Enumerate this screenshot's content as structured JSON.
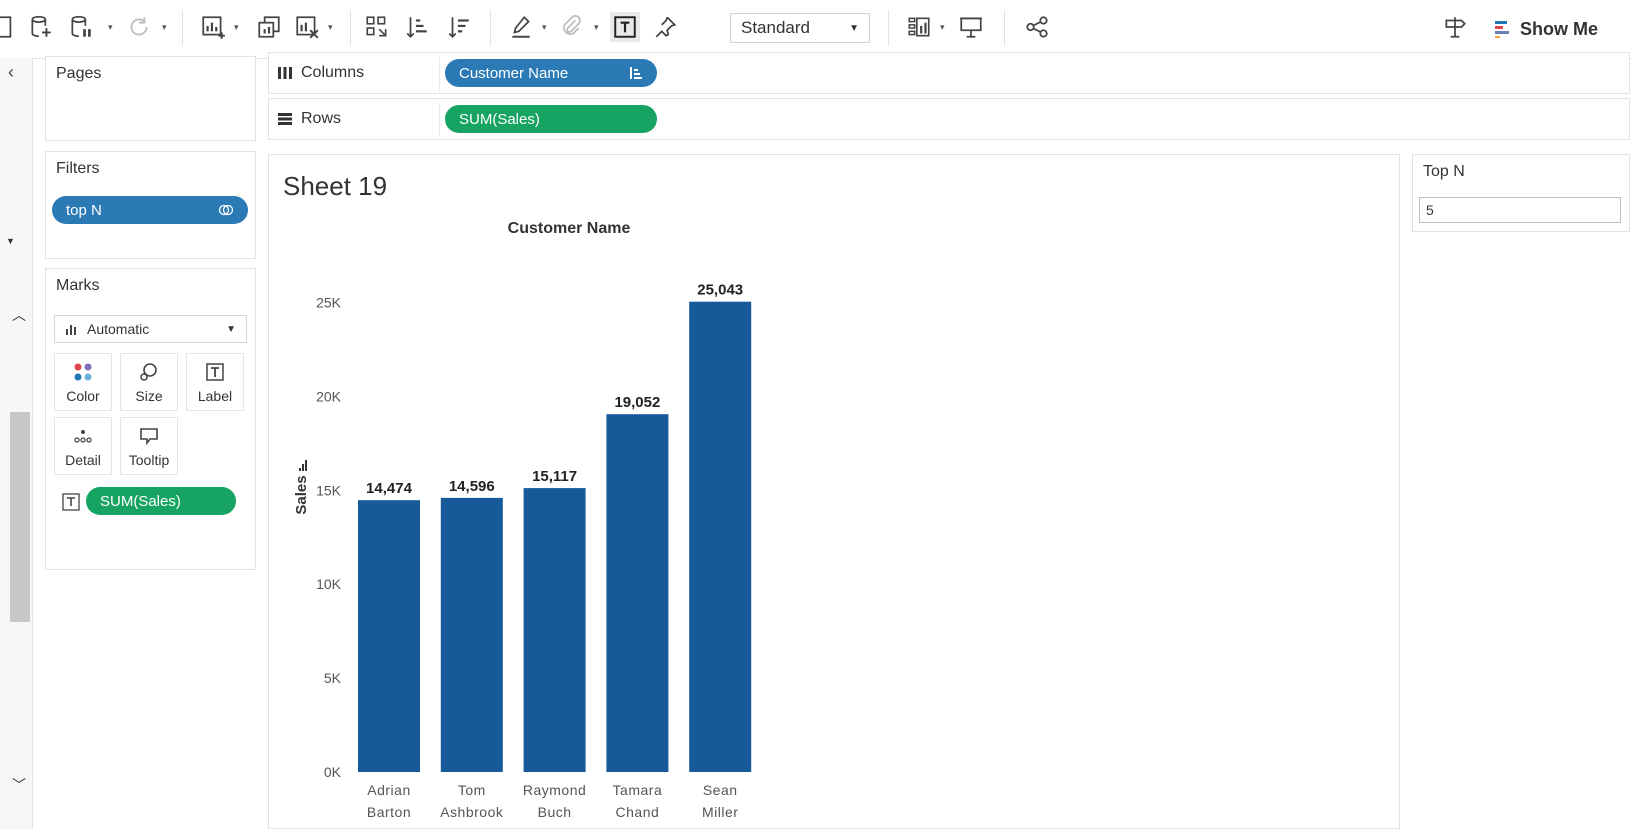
{
  "toolbar": {
    "fit_option": "Standard",
    "show_me_label": "Show Me"
  },
  "pages": {
    "title": "Pages"
  },
  "filters": {
    "title": "Filters",
    "pills": [
      {
        "label": "top N"
      }
    ]
  },
  "marks": {
    "title": "Marks",
    "mark_type": "Automatic",
    "buttons": {
      "color": "Color",
      "size": "Size",
      "label": "Label",
      "detail": "Detail",
      "tooltip": "Tooltip"
    },
    "label_pill": "SUM(Sales)"
  },
  "shelves": {
    "columns": {
      "label": "Columns",
      "pill": "Customer Name"
    },
    "rows": {
      "label": "Rows",
      "pill": "SUM(Sales)"
    }
  },
  "sheet": {
    "title": "Sheet 19"
  },
  "parameter": {
    "title": "Top N",
    "value": "5"
  },
  "chart_data": {
    "type": "bar",
    "title": "Customer Name",
    "xlabel": "",
    "ylabel": "Sales",
    "categories": [
      [
        "Adrian",
        "Barton"
      ],
      [
        "Tom",
        "Ashbrook"
      ],
      [
        "Raymond",
        "Buch"
      ],
      [
        "Tamara",
        "Chand"
      ],
      [
        "Sean",
        "Miller"
      ]
    ],
    "values": [
      14474,
      14596,
      15117,
      19052,
      25043
    ],
    "value_labels": [
      "14,474",
      "14,596",
      "15,117",
      "19,052",
      "25,043"
    ],
    "ylim": [
      0,
      25000
    ],
    "yticks": [
      0,
      5000,
      10000,
      15000,
      20000,
      25000
    ],
    "ytick_labels": [
      "0K",
      "5K",
      "10K",
      "15K",
      "20K",
      "25K"
    ],
    "bar_color": "#165a99",
    "grid": false
  }
}
